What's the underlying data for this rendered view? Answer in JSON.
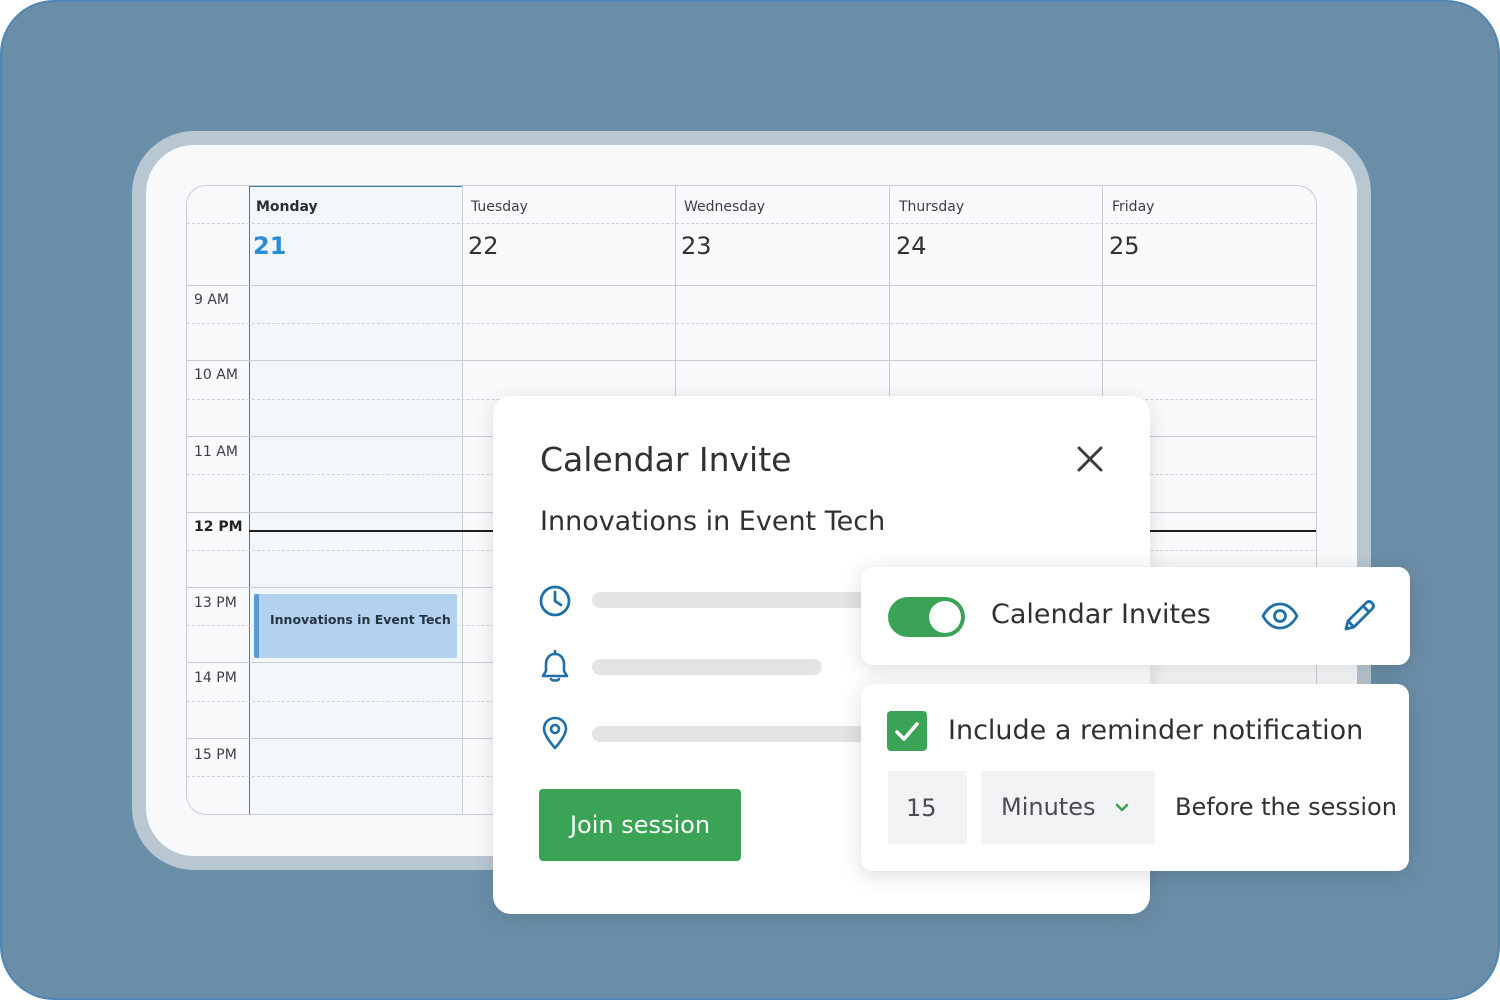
{
  "calendar": {
    "days": [
      {
        "name": "Monday",
        "date": "21"
      },
      {
        "name": "Tuesday",
        "date": "22"
      },
      {
        "name": "Wednesday",
        "date": "23"
      },
      {
        "name": "Thursday",
        "date": "24"
      },
      {
        "name": "Friday",
        "date": "25"
      }
    ],
    "times": [
      "9 AM",
      "10 AM",
      "11 AM",
      "12 PM",
      "13 PM",
      "14 PM",
      "15 PM"
    ],
    "event": {
      "title": "Innovations in Event Tech"
    }
  },
  "invite": {
    "title": "Calendar Invite",
    "event_name": "Innovations in Event Tech",
    "join_label": "Join session"
  },
  "invites_toggle": {
    "label": "Calendar Invites",
    "enabled": true
  },
  "reminder": {
    "label": "Include a reminder notification",
    "checked": true,
    "amount": "15",
    "unit": "Minutes",
    "suffix": "Before the session"
  },
  "colors": {
    "accent_green": "#3aa355",
    "accent_blue": "#2a8bd6",
    "icon_blue": "#1f6fa8",
    "background": "#6b8ea8"
  },
  "icons": [
    "close-icon",
    "clock-icon",
    "bell-icon",
    "location-pin-icon",
    "eye-icon",
    "pencil-icon",
    "checkmark-icon",
    "chevron-down-icon"
  ]
}
